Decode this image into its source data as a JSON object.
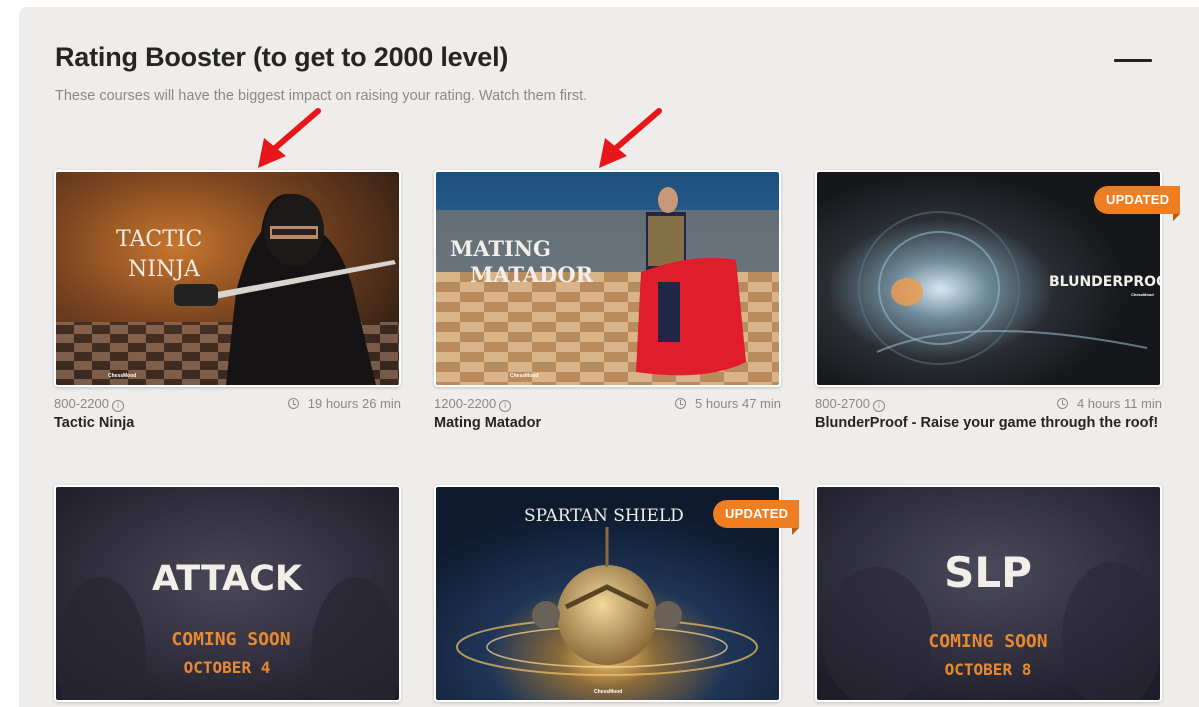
{
  "section": {
    "title": "Rating Booster (to get to 2000 level)",
    "subtitle": "These courses will have the biggest impact on raising your rating. Watch them first."
  },
  "icons": {
    "collapse": "minus-icon",
    "info": "info-icon",
    "clock": "clock-icon",
    "annotation": "red-arrow-icon"
  },
  "colors": {
    "panel_bg": "#efedeb",
    "badge": "#ef7d22",
    "annotation_arrow": "#e8161a",
    "text": "#262522",
    "muted": "#8b8987"
  },
  "courses": [
    {
      "art_text": "TACTIC NINJA",
      "art_line1": "TACTIC",
      "art_line2": "NINJA",
      "logo": "ChessMood",
      "range": "800-2200",
      "duration": "19 hours 26 min",
      "title": "Tactic Ninja"
    },
    {
      "art_text": "MATING MATADOR",
      "art_line1": "MATING",
      "art_line2": "MATADOR",
      "logo": "ChessMood",
      "range": "1200-2200",
      "duration": "5 hours 47 min",
      "title": "Mating Matador"
    },
    {
      "art_text": "BLUNDERPROOF",
      "logo": "ChessMood",
      "badge": "UPDATED",
      "range": "800-2700",
      "duration": "4 hours 11 min",
      "title": "BlunderProof - Raise your game through the roof!"
    },
    {
      "art_text": "ATTACK",
      "coming": "COMING SOON",
      "date": "OCTOBER 4"
    },
    {
      "art_text": "SPARTAN SHIELD",
      "logo": "ChessMood",
      "badge": "UPDATED"
    },
    {
      "art_text": "SLP",
      "coming": "COMING SOON",
      "date": "OCTOBER 8"
    }
  ]
}
